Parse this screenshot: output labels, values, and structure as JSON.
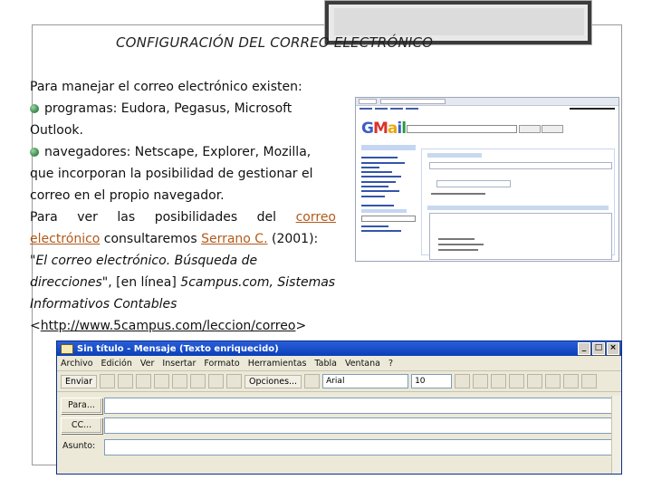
{
  "slide": {
    "title": "CONFIGURACIÓN DEL CORREO ELECTRÓNICO",
    "intro": "Para manejar el correo electrónico existen:",
    "bullet1": "programas: Eudora, Pegasus, Microsoft Outlook.",
    "bullet2_a": "navegadores: Netscape, Explorer, Mozilla,",
    "bullet2_b": "que incorporan la posibilidad de gestionar el",
    "bullet2_c": "correo en el propio navegador.",
    "para_a": "Para ver las posibilidades del",
    "link1_a": "correo",
    "link1_b": "electrónico",
    "para_b": "consultaremos",
    "link2": "Serrano C.",
    "para_c": "(2001): \"",
    "cite_title": "El correo electrónico. Búsqueda de direcciones",
    "para_d": "\", [en línea]",
    "cite_source": "5campus.com, Sistemas Informativos Contables",
    "url_open": "<",
    "url": "http://www.5campus.com/leccion/correo",
    "url_close": ">"
  },
  "gmail_screenshot": {
    "logo_letters": [
      "G",
      "M",
      "a",
      "i",
      "l"
    ]
  },
  "outlook_window": {
    "title": "Sin título - Mensaje (Texto enriquecido)",
    "menu": [
      "Archivo",
      "Edición",
      "Ver",
      "Insertar",
      "Formato",
      "Herramientas",
      "Tabla",
      "Ventana",
      "?"
    ],
    "toolbar": {
      "send": "Enviar",
      "options": "Opciones...",
      "font": "Arial",
      "size": "10"
    },
    "fields": {
      "to": "Para...",
      "cc": "CC...",
      "subject": "Asunto:"
    },
    "controls": [
      "_",
      "□",
      "×"
    ]
  }
}
